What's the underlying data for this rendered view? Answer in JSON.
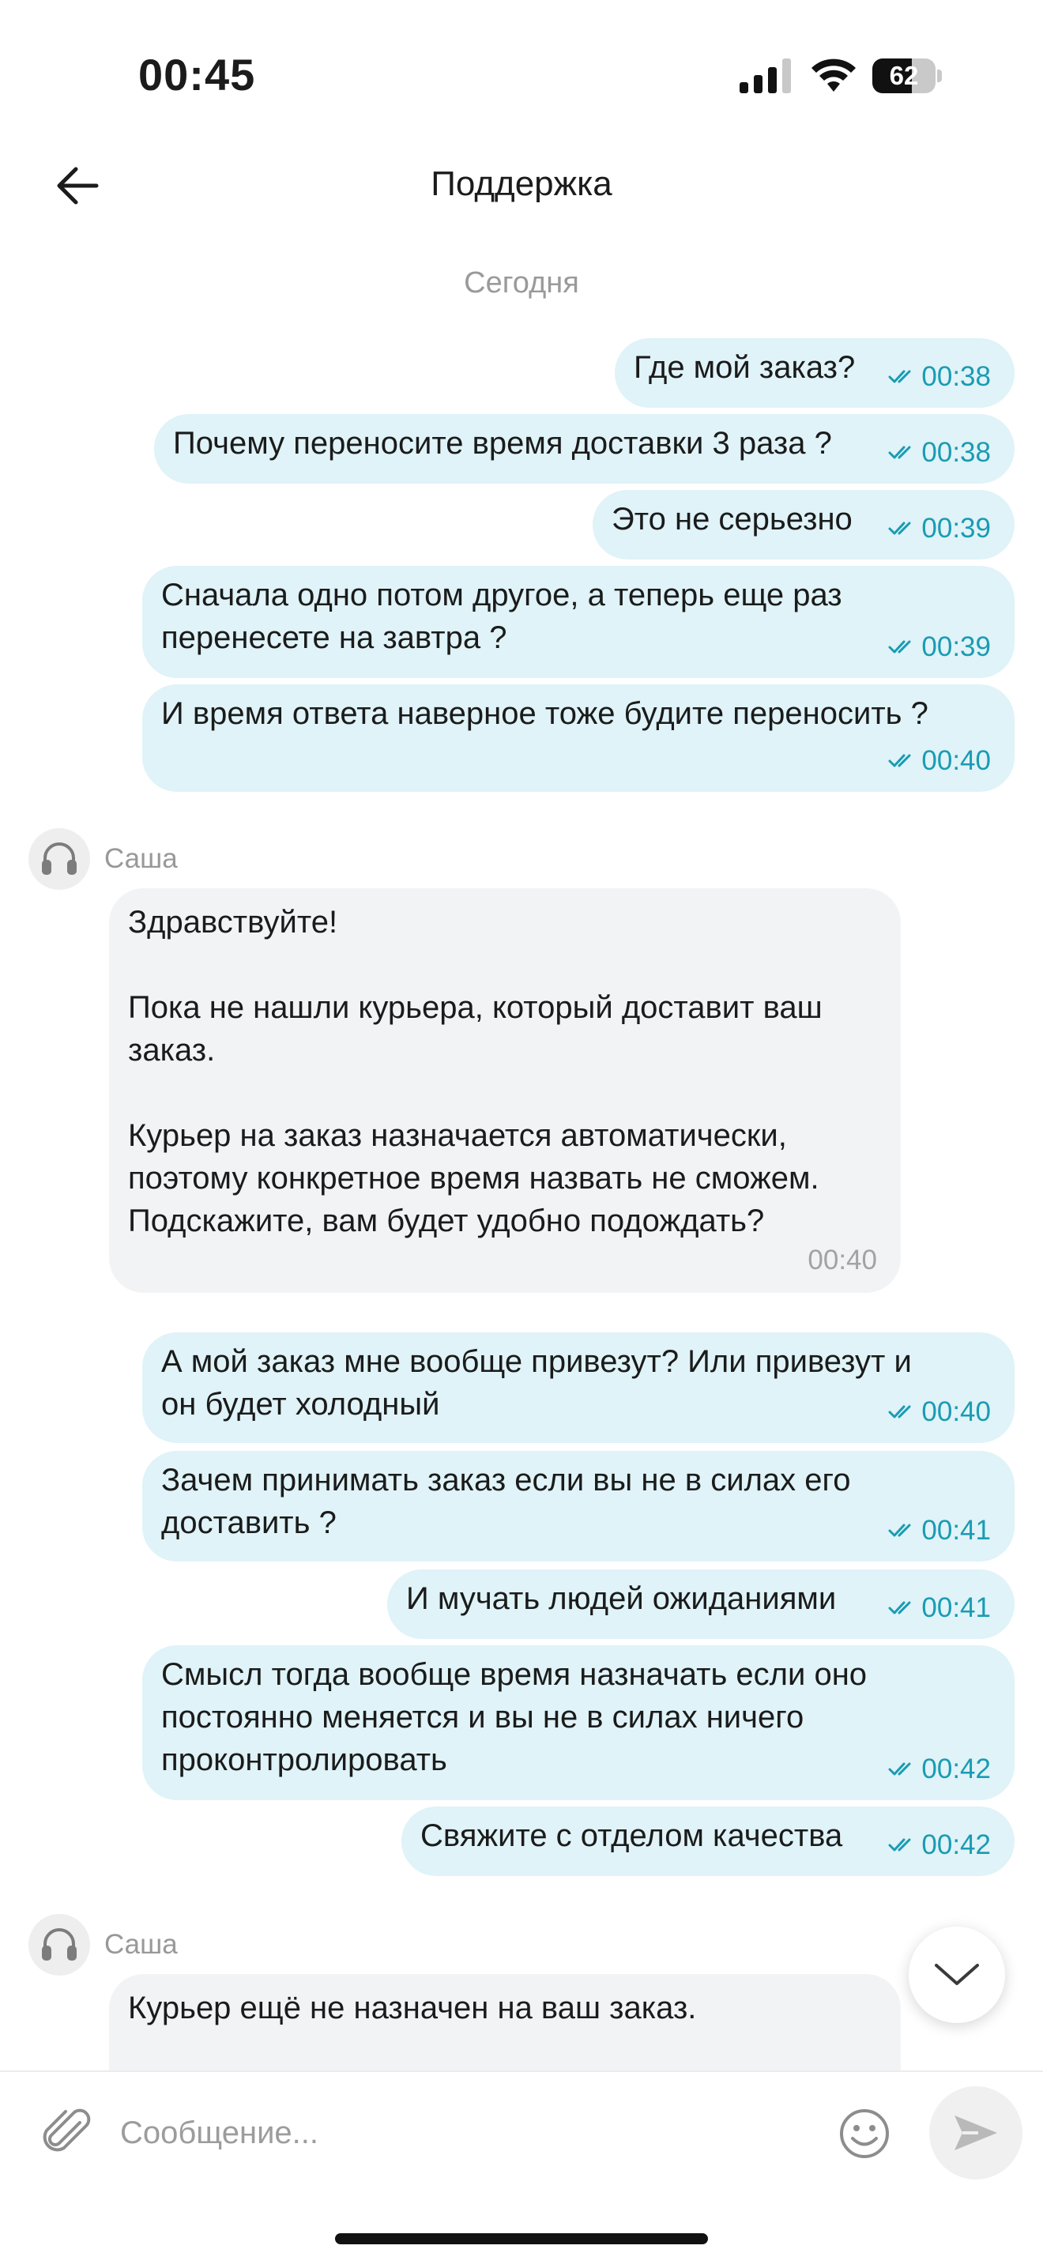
{
  "status_bar": {
    "time": "00:45",
    "battery": "62",
    "battery_fraction": 0.62
  },
  "header": {
    "title": "Поддержка"
  },
  "chat": {
    "date_separator": "Сегодня",
    "outgoing_group_1": [
      {
        "text": "Где мой заказ?",
        "time": "00:38"
      },
      {
        "text": "Почему переносите время доставки 3 раза ?",
        "time": "00:38"
      },
      {
        "text": "Это не серьезно",
        "time": "00:39"
      },
      {
        "text": "Сначала одно потом другое, а теперь еще раз\nперенесете на завтра ?",
        "time": "00:39"
      },
      {
        "text": "И время ответа наверное тоже будите переносить ?",
        "time": "00:40"
      }
    ],
    "incoming_1": {
      "sender": "Саша",
      "text": "Здравствуйте!\n\nПока не нашли курьера, который доставит ваш\nзаказ.\n\nКурьер на заказ назначается автоматически,\nпоэтому конкретное время назвать не сможем.\nПодскажите, вам будет удобно подождать?",
      "time": "00:40"
    },
    "outgoing_group_2": [
      {
        "text": "А мой заказ мне вообще привезут? Или привезут и\nон будет холодный",
        "time": "00:40"
      },
      {
        "text": "Зачем принимать заказ если вы не в силах его\nдоставить ?",
        "time": "00:41"
      },
      {
        "text": "И мучать людей ожиданиями",
        "time": "00:41"
      },
      {
        "text": "Смысл тогда вообще время назначать если оно\nпостоянно меняется и вы не в силах ничего\nпроконтролировать",
        "time": "00:42"
      },
      {
        "text": "Свяжите с отделом качества",
        "time": "00:42"
      }
    ],
    "incoming_2": {
      "sender": "Саша",
      "text": "Курьер ещё не назначен на ваш заказ."
    }
  },
  "composer": {
    "placeholder": "Сообщение..."
  },
  "colors": {
    "outgoing_bubble": "#dff3f8",
    "incoming_bubble": "#f2f3f5",
    "read_checkmarks": "#1a9bb3"
  },
  "icons": {
    "back": "arrow-left-icon",
    "agent_avatar": "headset-icon",
    "scroll_down": "chevron-down-icon",
    "attach": "paperclip-icon",
    "emoji": "smiley-icon",
    "send": "send-arrow-icon"
  }
}
